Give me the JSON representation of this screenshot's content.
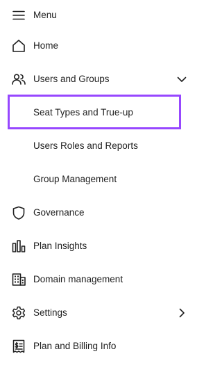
{
  "menu": {
    "title": "Menu",
    "items": [
      {
        "label": "Home",
        "icon": "home-icon"
      },
      {
        "label": "Users and Groups",
        "icon": "users-icon",
        "expanded": true
      },
      {
        "label": "Seat Types and True-up",
        "selected": true
      },
      {
        "label": "Users Roles and Reports"
      },
      {
        "label": "Group Management"
      },
      {
        "label": "Governance",
        "icon": "shield-icon"
      },
      {
        "label": "Plan Insights",
        "icon": "bar-chart-icon"
      },
      {
        "label": "Domain management",
        "icon": "building-icon"
      },
      {
        "label": "Settings",
        "icon": "gear-icon"
      },
      {
        "label": "Plan and Billing Info",
        "icon": "receipt-icon"
      }
    ]
  },
  "colors": {
    "text": "#1e1e1e",
    "selection_outline": "#9747ff",
    "background": "#ffffff"
  }
}
